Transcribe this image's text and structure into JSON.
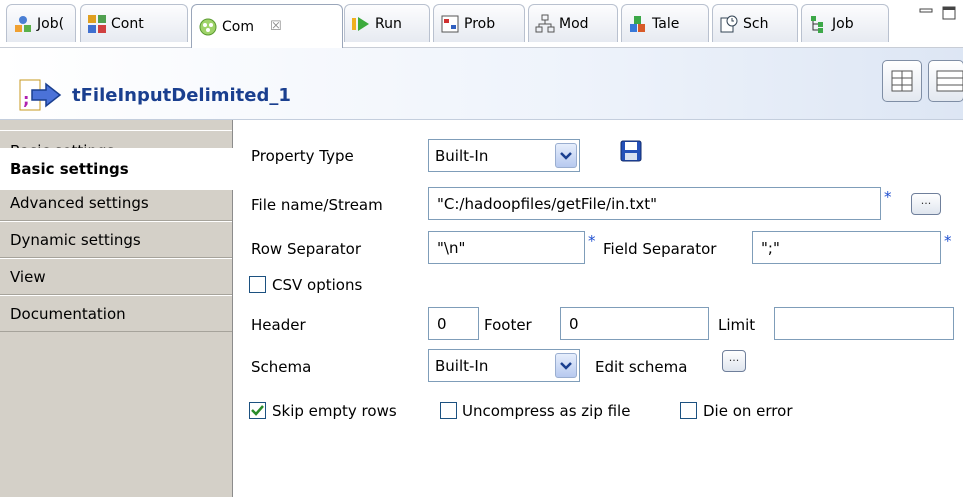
{
  "tabs": [
    {
      "label": "Job(",
      "icon": "job-icon"
    },
    {
      "label": "Cont",
      "icon": "contexts-icon"
    },
    {
      "label": "Com",
      "icon": "component-icon",
      "close": "☒"
    },
    {
      "label": "Run",
      "icon": "run-icon"
    },
    {
      "label": "Prob",
      "icon": "problems-icon"
    },
    {
      "label": "Mod",
      "icon": "modules-icon"
    },
    {
      "label": "Tale",
      "icon": "talend-icon"
    },
    {
      "label": "Sch",
      "icon": "scheduler-icon"
    },
    {
      "label": "Job",
      "icon": "job-hierarchy-icon"
    }
  ],
  "component": {
    "title": "tFileInputDelimited_1"
  },
  "nav": [
    "Basic settings",
    "Advanced settings",
    "Dynamic settings",
    "View",
    "Documentation"
  ],
  "form": {
    "property_type_label": "Property Type",
    "property_type_value": "Built-In",
    "file_label": "File name/Stream",
    "file_value": "\"C:/hadoopfiles/getFile/in.txt\"",
    "row_sep_label": "Row Separator",
    "row_sep_value": "\"\\n\"",
    "field_sep_label": "Field Separator",
    "field_sep_value": "\";\"",
    "required_mark": "*",
    "csv_label": "CSV options",
    "header_label": "Header",
    "header_value": "0",
    "footer_label": "Footer",
    "footer_value": "0",
    "limit_label": "Limit",
    "limit_value": "",
    "schema_label": "Schema",
    "schema_value": "Built-In",
    "edit_schema_label": "Edit schema",
    "dots": "...",
    "skip_empty_label": "Skip empty rows",
    "skip_empty_checked": true,
    "uncompress_label": "Uncompress as zip file",
    "uncompress_checked": false,
    "die_on_error_label": "Die on error",
    "die_on_error_checked": false,
    "csv_checked": false
  },
  "colors": {
    "title": "#1a3f8f",
    "required": "#1f4fd0"
  }
}
